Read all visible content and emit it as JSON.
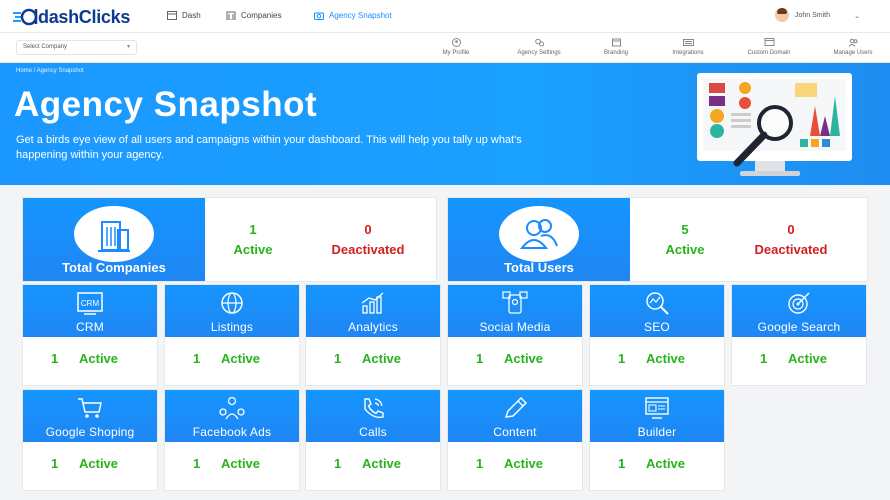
{
  "topnav": {
    "logo_text": "dashClicks",
    "links": [
      {
        "label": "Dash",
        "icon": "dashboard-icon"
      },
      {
        "label": "Companies",
        "icon": "building-icon"
      },
      {
        "label": "Agency Snapshot",
        "icon": "camera-icon"
      }
    ],
    "user_name": "John Smith"
  },
  "subnav": {
    "select_placeholder": "Select Company",
    "items": [
      {
        "label": "My Profile",
        "icon": "profile-icon"
      },
      {
        "label": "Agency Settings",
        "icon": "settings-icon"
      },
      {
        "label": "Branding",
        "icon": "branding-icon"
      },
      {
        "label": "Integrations",
        "icon": "integrations-icon"
      },
      {
        "label": "Custom Domain",
        "icon": "domain-icon"
      },
      {
        "label": "Manage Users",
        "icon": "users-icon"
      }
    ]
  },
  "hero": {
    "breadcrumb": "Home / Agency Snapshot",
    "title": "Agency Snapshot",
    "description": "Get a birds eye view of all users and campaigns within your dashboard. This will help you tally up what's happening within your agency."
  },
  "stats": [
    {
      "label": "Total Companies",
      "active_count": "1",
      "active_label": "Active",
      "deactivated_count": "0",
      "deactivated_label": "Deactivated",
      "icon": "building-icon"
    },
    {
      "label": "Total Users",
      "active_count": "5",
      "active_label": "Active",
      "deactivated_count": "0",
      "deactivated_label": "Deactivated",
      "icon": "users-icon"
    }
  ],
  "tiles": [
    {
      "label": "CRM",
      "count": "1",
      "status": "Active",
      "icon": "crm-icon"
    },
    {
      "label": "Listings",
      "count": "1",
      "status": "Active",
      "icon": "listings-icon"
    },
    {
      "label": "Analytics",
      "count": "1",
      "status": "Active",
      "icon": "analytics-icon"
    },
    {
      "label": "Social Media",
      "count": "1",
      "status": "Active",
      "icon": "social-media-icon"
    },
    {
      "label": "SEO",
      "count": "1",
      "status": "Active",
      "icon": "seo-icon"
    },
    {
      "label": "Google Search",
      "count": "1",
      "status": "Active",
      "icon": "google-search-icon"
    },
    {
      "label": "Google Shoping",
      "count": "1",
      "status": "Active",
      "icon": "cart-icon"
    },
    {
      "label": "Facebook Ads",
      "count": "1",
      "status": "Active",
      "icon": "facebook-ads-icon"
    },
    {
      "label": "Calls",
      "count": "1",
      "status": "Active",
      "icon": "phone-icon"
    },
    {
      "label": "Content",
      "count": "1",
      "status": "Active",
      "icon": "pencil-icon"
    },
    {
      "label": "Builder",
      "count": "1",
      "status": "Active",
      "icon": "builder-icon"
    }
  ],
  "colors": {
    "accent": "#1a8cff",
    "active": "#29b31c",
    "deactivated": "#d11e1e",
    "logo": "#0d3a8f"
  }
}
